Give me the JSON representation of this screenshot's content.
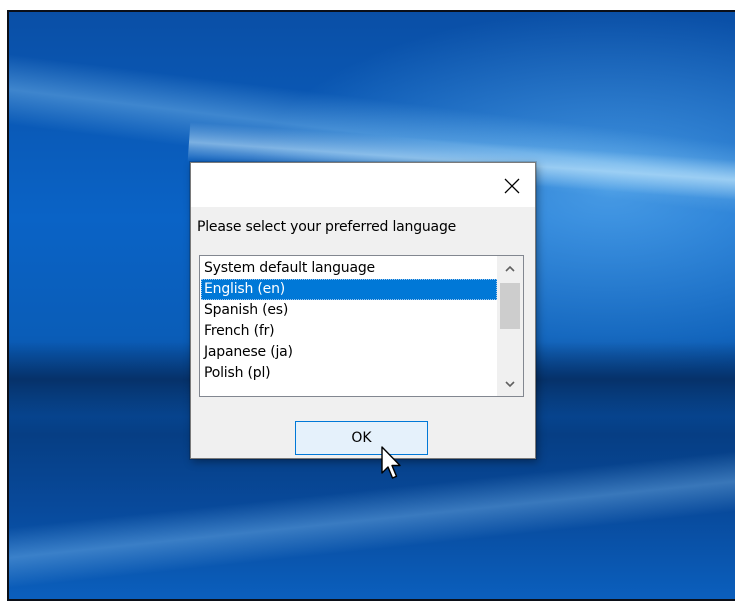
{
  "dialog": {
    "prompt": "Please select your preferred language",
    "close_icon": "close-icon",
    "languages": [
      "System default language",
      "English (en)",
      "Spanish (es)",
      "French (fr)",
      "Japanese (ja)",
      "Polish (pl)"
    ],
    "selected_language": "English (en)",
    "ok_label": "OK"
  },
  "icons": {
    "scroll_up": "chevron-up-icon",
    "scroll_down": "chevron-down-icon",
    "cursor": "mouse-pointer-icon"
  },
  "colors": {
    "selection": "#0078d7",
    "button_focus_border": "#0078d7",
    "button_fill": "#e5f1fb",
    "desktop_blue": "#0a63c6"
  }
}
